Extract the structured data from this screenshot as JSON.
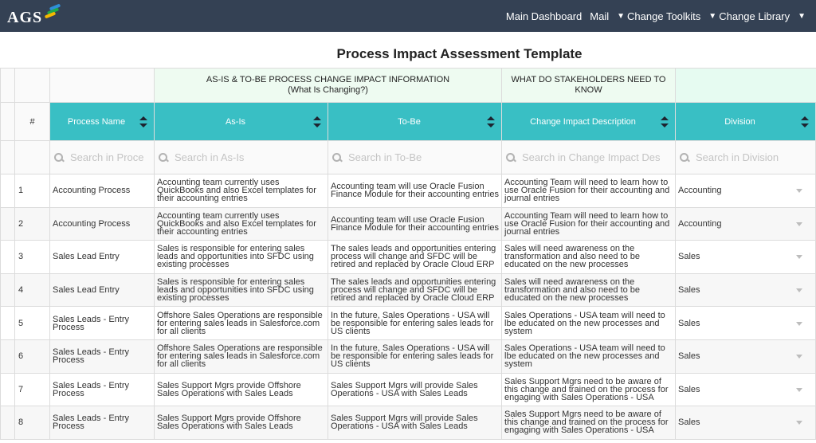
{
  "topbar": {
    "logo_text": "AGS",
    "nav": [
      {
        "label": "Main Dashboard",
        "dropdown": false
      },
      {
        "label": "Mail",
        "dropdown": false
      },
      {
        "label": "Change Toolkits",
        "dropdown": true
      },
      {
        "label": "Change Library",
        "dropdown": true
      }
    ]
  },
  "page_title": "Process Impact Assessment Template",
  "groups": {
    "as_is_to_be_line1": "AS-IS & TO-BE PROCESS CHANGE IMPACT INFORMATION",
    "as_is_to_be_line2": "(What Is Changing?)",
    "stakeholders_line1": "WHAT DO STAKEHOLDERS NEED TO",
    "stakeholders_line2": "KNOW"
  },
  "columns": {
    "num": "#",
    "process_name": "Process Name",
    "as_is": "As-Is",
    "to_be": "To-Be",
    "change_impact": "Change Impact Description",
    "division": "Division"
  },
  "search": {
    "process_name": "Search in Proce",
    "as_is": "Search in As-Is",
    "to_be": "Search in To-Be",
    "change_impact": "Search in Change Impact Des",
    "division": "Search in Division"
  },
  "rows": [
    {
      "num": "1",
      "process": "Accounting Process",
      "as_is": "Accounting team currently uses QuickBooks and also Excel templates for their accounting entries",
      "to_be": "Accounting team will use Oracle Fusion Finance Module for their accounting entries",
      "impact": "Accounting Team will need to learn how to use Oracle Fusion for their accounting and journal entries",
      "division": "Accounting"
    },
    {
      "num": "2",
      "process": "Accounting Process",
      "as_is": "Accounting team currently uses QuickBooks and also Excel templates for their accounting entries",
      "to_be": "Accounting team will use Oracle Fusion Finance Module for their accounting entries",
      "impact": "Accounting Team will need to learn how to use Oracle Fusion for their accounting and journal entries",
      "division": "Accounting"
    },
    {
      "num": "3",
      "process": "Sales Lead Entry",
      "as_is": "Sales is responsible for entering sales leads and opportunities into SFDC using existing processes",
      "to_be": "The sales leads and opportunities entering process will change and SFDC will be retired and replaced by Oracle Cloud ERP",
      "impact": "Sales will need awareness on the transformation and also need to be educated on the new processes",
      "division": "Sales"
    },
    {
      "num": "4",
      "process": "Sales Lead Entry",
      "as_is": "Sales is responsible for entering sales leads and opportunities into SFDC using existing processes",
      "to_be": "The sales leads and opportunities entering process will change and SFDC will be retired and replaced by Oracle Cloud ERP",
      "impact": "Sales will need awareness on the transformation and also need to be educated on the new processes",
      "division": "Sales"
    },
    {
      "num": "5",
      "process": "Sales Leads - Entry Process",
      "as_is": "Offshore Sales Operations are responsible for entering sales leads in Salesforce.com for all clients",
      "to_be": "In the future, Sales Operations - USA will be responsible for entering sales leads for US clients",
      "impact": "Sales Operations - USA team will need to lbe educated on the new processes and system",
      "division": "Sales"
    },
    {
      "num": "6",
      "process": "Sales Leads - Entry Process",
      "as_is": "Offshore Sales Operations are responsible for entering sales leads in Salesforce.com for all clients",
      "to_be": "In the future, Sales Operations - USA will be responsible for entering sales leads for US clients",
      "impact": "Sales Operations - USA team will need to lbe educated on the new processes and system",
      "division": "Sales"
    },
    {
      "num": "7",
      "process": "Sales Leads - Entry Process",
      "as_is": "Sales Support Mgrs provide Offshore Sales Operations with Sales Leads",
      "to_be": "Sales Support Mgrs will provide Sales Operations - USA with Sales Leads",
      "impact": "Sales Support Mgrs need to be aware of this change and trained on the process for engaging with Sales Operations - USA",
      "division": "Sales"
    },
    {
      "num": "8",
      "process": "Sales Leads - Entry Process",
      "as_is": "Sales Support Mgrs provide Offshore Sales Operations with Sales Leads",
      "to_be": "Sales Support Mgrs will provide Sales Operations - USA with Sales Leads",
      "impact": "Sales Support Mgrs need to be aware of this change and trained on the process for engaging with Sales Operations - USA",
      "division": "Sales"
    }
  ]
}
